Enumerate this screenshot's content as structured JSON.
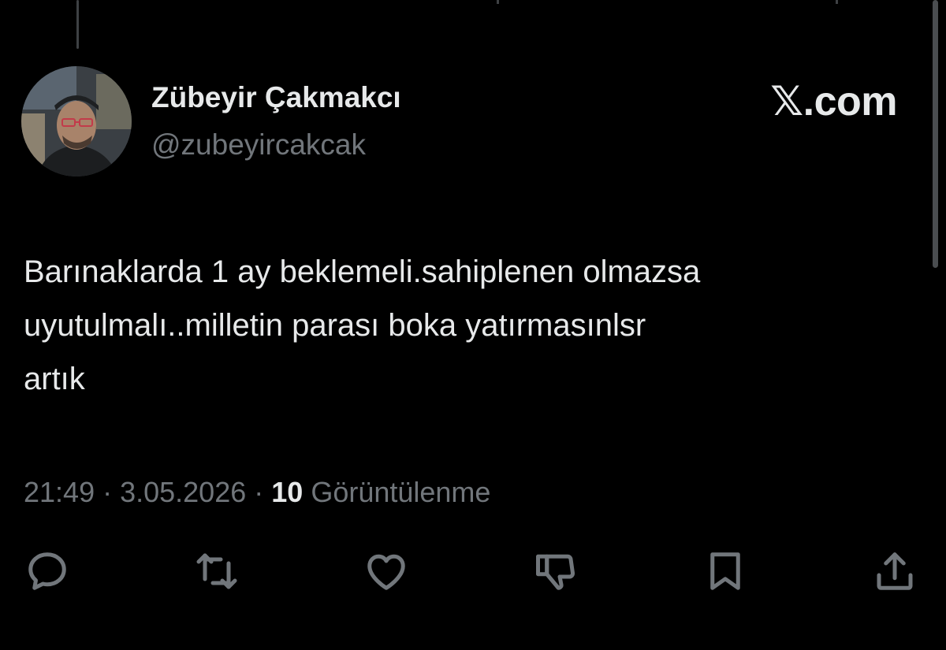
{
  "author": {
    "display_name": "Zübeyir Çakmakcı",
    "handle": "@zubeyircakcak"
  },
  "brand": {
    "label": "𝕏.com"
  },
  "tweet": {
    "lines": [
      "Barınaklarda 1 ay beklemeli.sahiplenen olmazsa",
      "uyutulmalı..milletin parası boka yatırmasınlsr",
      "artık"
    ]
  },
  "meta": {
    "time": "21:49",
    "separator": " · ",
    "date": "3.05.2026",
    "views_count": "10",
    "views_label": "Görüntülenme"
  },
  "actions": [
    {
      "name": "reply",
      "icon": "reply-icon"
    },
    {
      "name": "retweet",
      "icon": "retweet-icon"
    },
    {
      "name": "like",
      "icon": "heart-icon"
    },
    {
      "name": "dislike",
      "icon": "thumbs-down-icon"
    },
    {
      "name": "bookmark",
      "icon": "bookmark-icon"
    },
    {
      "name": "share",
      "icon": "share-icon"
    }
  ],
  "colors": {
    "background": "#000000",
    "primary_text": "#e7e9ea",
    "secondary_text": "#71767b",
    "thread_line": "#3e4144"
  }
}
